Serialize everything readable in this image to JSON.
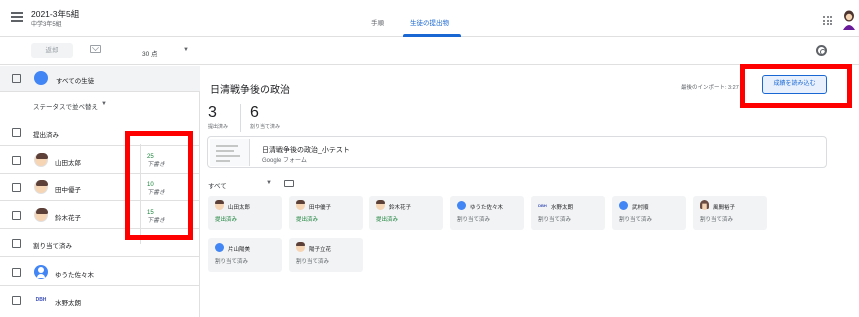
{
  "header": {
    "class_title": "2021-3年5組",
    "class_subtitle": "中学3年5組",
    "tabs": [
      {
        "label": "手順"
      },
      {
        "label": "生徒の提出物"
      }
    ]
  },
  "toolbar": {
    "return_label": "返却",
    "points": "30 点"
  },
  "sidebar": {
    "all_students": "すべての生徒",
    "sort_label": "ステータスで並べ替え",
    "submitted_group": "提出済み",
    "assigned_group": "割り当て済み",
    "students_submitted": [
      {
        "name": "山田太郎",
        "grade": "25",
        "status": "下書き"
      },
      {
        "name": "田中優子",
        "grade": "10",
        "status": "下書き"
      },
      {
        "name": "鈴木花子",
        "grade": "15",
        "status": "下書き"
      }
    ],
    "students_assigned": [
      {
        "name": "ゆうた佐々木"
      },
      {
        "name": "水野太朗"
      }
    ],
    "dbh_badge": "DBH"
  },
  "main": {
    "title": "日清戦争後の政治",
    "import_label": "最後のインポート: 3:27",
    "import_button": "成績を読み込む",
    "stats": [
      {
        "num": "3",
        "label": "提出済み"
      },
      {
        "num": "6",
        "label": "割り当て済み"
      }
    ],
    "attachment": {
      "title": "日清戦争後の政治_小テスト",
      "type": "Google フォーム"
    },
    "filter_label": "すべて",
    "cards": [
      {
        "name": "山田太郎",
        "status": "提出済み"
      },
      {
        "name": "田中優子",
        "status": "提出済み"
      },
      {
        "name": "鈴木花子",
        "status": "提出済み"
      },
      {
        "name": "ゆうた佐々木",
        "status": "割り当て済み"
      },
      {
        "name": "水野太朗",
        "status": "割り当て済み"
      },
      {
        "name": "武村順",
        "status": "割り当て済み"
      },
      {
        "name": "風間裕子",
        "status": "割り当て済み"
      },
      {
        "name": "片山陽美",
        "status": "割り当て済み"
      },
      {
        "name": "陽子立花",
        "status": "割り当て済み"
      }
    ]
  },
  "colors": {
    "accent": "#1967d2",
    "submitted_green": "#188038",
    "highlight_red": "#ff0000"
  }
}
